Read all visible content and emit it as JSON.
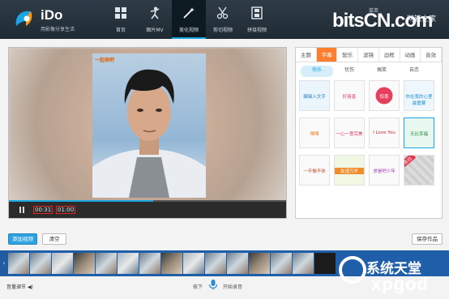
{
  "app": {
    "name": "iDo",
    "slogan": "用影像分享生活"
  },
  "nav": [
    {
      "label": "首页",
      "icon": "grid-icon"
    },
    {
      "label": "图片MV",
      "icon": "dancer-icon"
    },
    {
      "label": "美化视频",
      "icon": "magic-wand-icon"
    },
    {
      "label": "剪切视频",
      "icon": "scissors-icon"
    },
    {
      "label": "拼接视频",
      "icon": "film-icon"
    }
  ],
  "header_right": {
    "text": "菜单"
  },
  "watermark_top": {
    "brand": "bitsCN.com",
    "subtitle": "网管之家"
  },
  "player": {
    "photo_logo": "一起来吧",
    "current_time": "00:31",
    "total_time": "01:00",
    "progress": 0.52
  },
  "panel": {
    "tabs": [
      "主题",
      "字幕",
      "配乐",
      "滤镜",
      "边框",
      "动画",
      "音效"
    ],
    "active_tab": "字幕",
    "subtabs": [
      "快乐",
      "忧伤",
      "搞笑",
      "自恋"
    ],
    "active_subtab": "快乐",
    "stickers": [
      {
        "text": "编辑入文字"
      },
      {
        "text": "好害羞"
      },
      {
        "text": "惊喜"
      },
      {
        "text": "你在我的心里最重要"
      },
      {
        "text": "嘿嘿"
      },
      {
        "text": "一心一意完美"
      },
      {
        "text": "I Love You"
      },
      {
        "text": "无比幸福"
      },
      {
        "text": "一不做不休"
      },
      {
        "text": "友谊万岁"
      },
      {
        "text": "求是吧少年"
      },
      {
        "text": "告白"
      }
    ]
  },
  "buttons": {
    "add_video": "添加视频",
    "clear": "清空",
    "save": "保存作品"
  },
  "watermark_bottom": {
    "cn": "系统天堂",
    "en": "xpgod"
  },
  "footer": {
    "volume_label": "音量调节",
    "hold_label": "按下",
    "record_label": "开始录音"
  }
}
